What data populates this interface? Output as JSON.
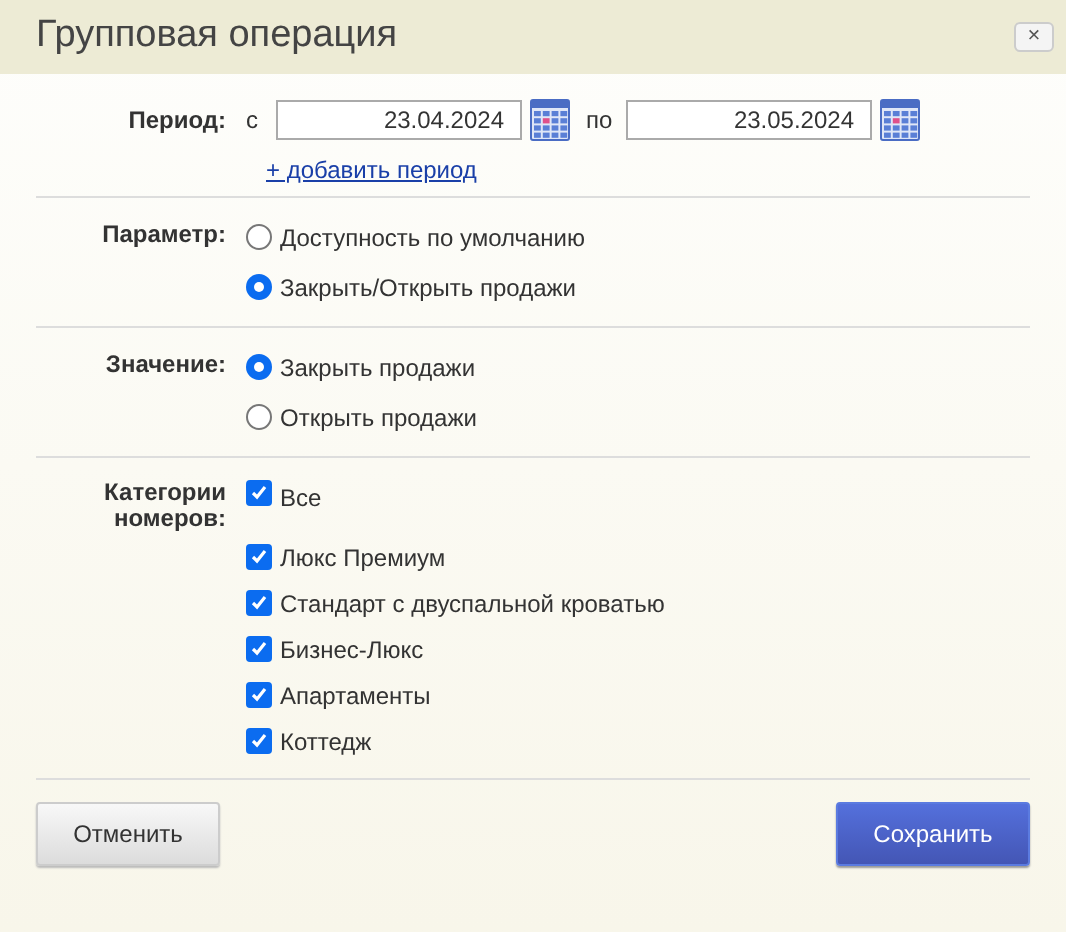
{
  "window": {
    "title": "Групповая операция",
    "close": "×"
  },
  "period": {
    "label": "Период:",
    "from_label": "с",
    "from": "23.04.2024",
    "to_label": "по",
    "to": "23.05.2024",
    "add_link": "+ добавить период"
  },
  "parameter": {
    "label": "Параметр:",
    "options": [
      {
        "label": "Доступность по умолчанию",
        "selected": false
      },
      {
        "label": "Закрыть/Открыть продажи",
        "selected": true
      }
    ]
  },
  "value": {
    "label": "Значение:",
    "options": [
      {
        "label": "Закрыть продажи",
        "selected": true
      },
      {
        "label": "Открыть продажи",
        "selected": false
      }
    ]
  },
  "categories": {
    "label": "Категории номеров:",
    "items": [
      {
        "label": "Все",
        "checked": true
      },
      {
        "label": "Люкс Премиум",
        "checked": true
      },
      {
        "label": "Стандарт с двуспальной кроватью",
        "checked": true
      },
      {
        "label": "Бизнес-Люкс",
        "checked": true
      },
      {
        "label": "Апартаменты",
        "checked": true
      },
      {
        "label": "Коттедж",
        "checked": true
      }
    ]
  },
  "buttons": {
    "cancel": "Отменить",
    "save": "Сохранить"
  }
}
